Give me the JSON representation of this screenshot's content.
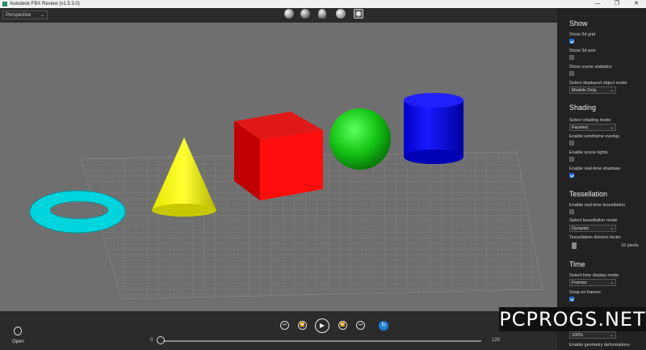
{
  "window": {
    "title": "Autodesk FBX Review (v1.5.3.0)",
    "minimize": "—",
    "maximize": "❐",
    "close": "✕"
  },
  "toolbar": {
    "view_mode": "Perspective"
  },
  "panel": {
    "show": {
      "heading": "Show",
      "grid_label": "Show 3d grid",
      "grid_checked": true,
      "axis_label": "Show 3d axis",
      "axis_checked": false,
      "stats_label": "Show scene statistics",
      "stats_checked": false,
      "object_mode_label": "Select displayed object mode",
      "object_mode_value": "Models Only"
    },
    "shading": {
      "heading": "Shading",
      "mode_label": "Select shading mode",
      "mode_value": "Faceted",
      "wireframe_label": "Enable wireframe overlay",
      "wireframe_checked": false,
      "lights_label": "Enable scene lights",
      "lights_checked": false,
      "shadows_label": "Enable real-time shadows",
      "shadows_checked": true
    },
    "tessellation": {
      "heading": "Tessellation",
      "realtime_label": "Enable real-time tessellation",
      "realtime_checked": false,
      "mode_label": "Select tessellation mode",
      "mode_value": "Dynamic",
      "factor_label": "Tessellation division factor",
      "factor_value": "16 pixels"
    },
    "time": {
      "heading": "Time",
      "display_label": "Select time display mode",
      "display_value": "Frames",
      "snap_label": "Snap on frames",
      "snap_checked": true,
      "partial_value": "100%",
      "deform_label": "Enable geometry deformations"
    }
  },
  "bottom": {
    "open_label": "Open",
    "start": "0",
    "end": "120"
  },
  "watermark": "PCPROGS.NET"
}
